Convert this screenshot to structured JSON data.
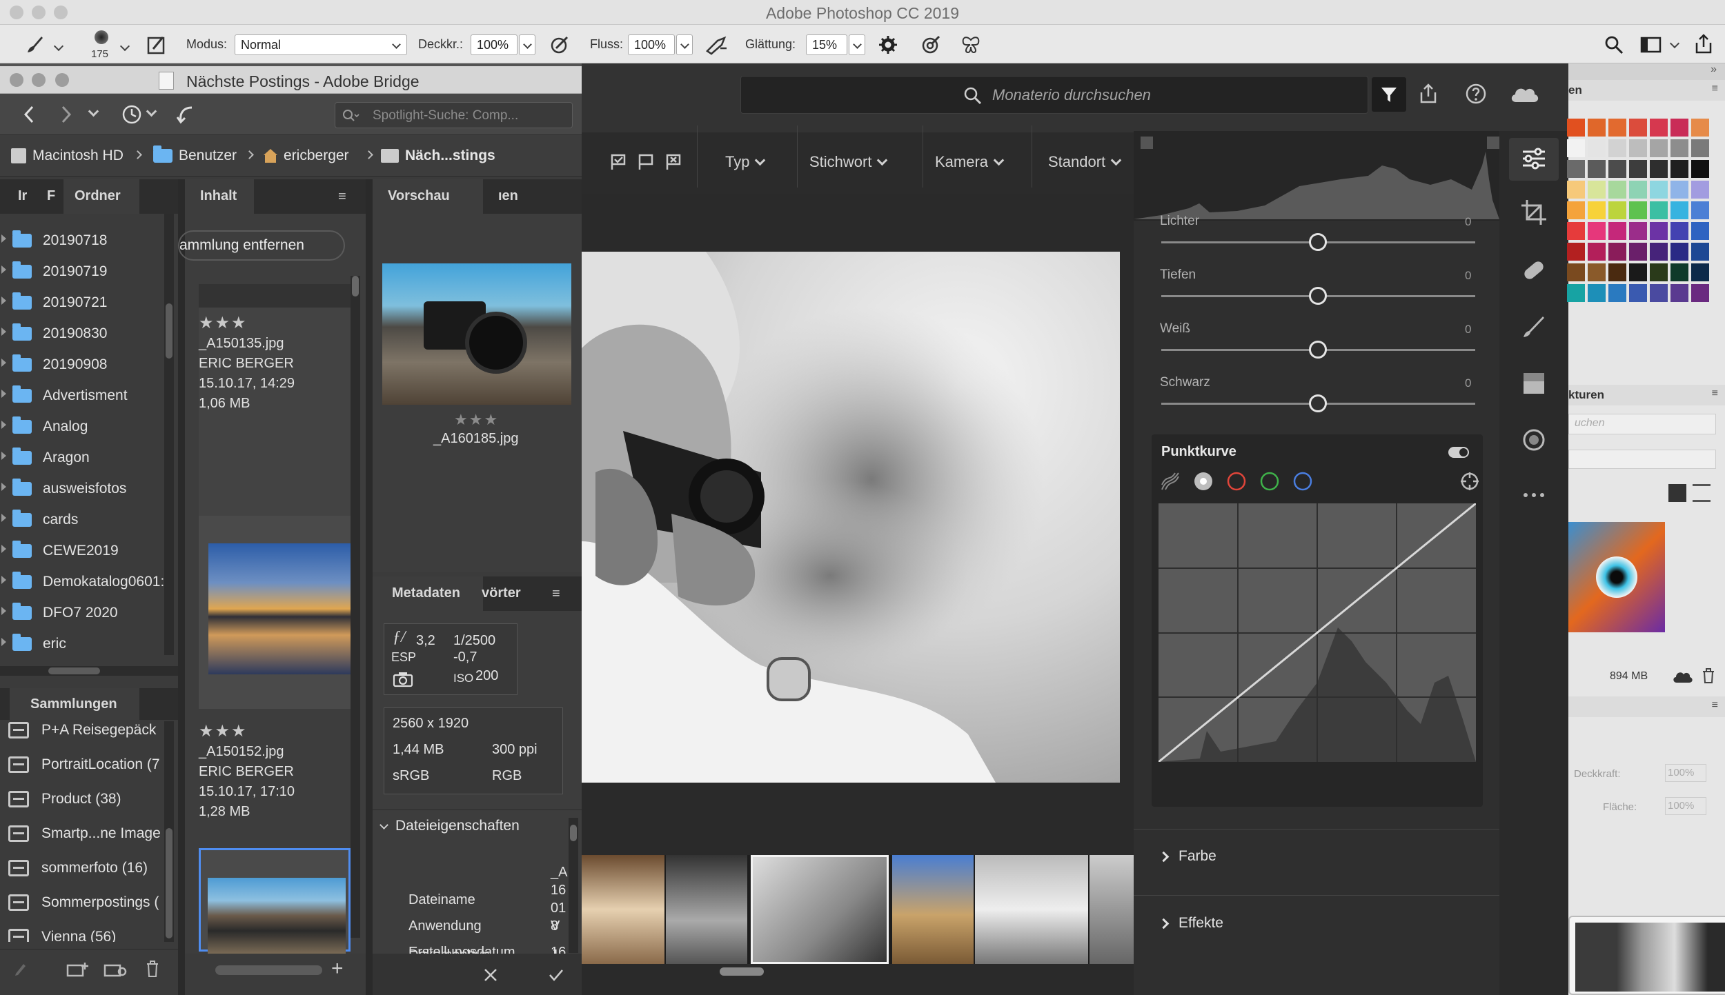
{
  "photoshop": {
    "title": "Adobe Photoshop CC 2019",
    "options": {
      "brush_size": "175",
      "mode_label": "Modus:",
      "mode_value": "Normal",
      "opacity_label": "Deckkr.:",
      "opacity_value": "100%",
      "flow_label": "Fluss:",
      "flow_value": "100%",
      "smoothing_label": "Glättung:",
      "smoothing_value": "15%"
    },
    "right_panels": {
      "tab_swatches": "en",
      "tab_textures": "kturen",
      "search_placeholder": "uchen",
      "cloud_size": "894 MB",
      "opacity_label": "Deckkraft:",
      "opacity_value": "100%",
      "fill_label": "Fläche:",
      "fill_value": "100%"
    }
  },
  "bridge": {
    "title": "Nächste Postings - Adobe Bridge",
    "search_placeholder": "Spotlight-Suche: Comp...",
    "breadcrumb": [
      "Macintosh HD",
      "Benutzer",
      "ericberger",
      "Näch...stings"
    ],
    "left_tabs": [
      "Ir",
      "F",
      "Ordner"
    ],
    "folders": [
      "20190718",
      "20190719",
      "20190721",
      "20190830",
      "20190908",
      "Advertisment",
      "Analog",
      "Aragon",
      "ausweisfotos",
      "cards",
      "CEWE2019",
      "Demokatalog0601:",
      "DFO7 2020",
      "eric"
    ],
    "collections_tab": "Sammlungen",
    "collections": [
      "P+A Reisegepäck",
      "PortraitLocation (7",
      "Product  (38)",
      "Smartp...ne Image",
      "sommerfoto  (16)",
      "Sommerpostings  (",
      "Vienna  (56)"
    ],
    "content_tab": "Inhalt",
    "remove_button": "ammlung entfernen",
    "items": [
      {
        "stars": "★★★",
        "file": "_A150135.jpg",
        "author": "ERIC BERGER",
        "date": "15.10.17, 14:29",
        "size": "1,06 MB"
      },
      {
        "stars": "★★★",
        "file": "_A150152.jpg",
        "author": "ERIC BERGER",
        "date": "15.10.17, 17:10",
        "size": "1,28 MB"
      }
    ],
    "preview_tab": "Vorschau",
    "preview_tab2": "ıen",
    "preview": {
      "stars": "★★★",
      "file": "_A160185.jpg"
    },
    "metadata_tab": "Metadaten",
    "metadata_tab2": "vörter",
    "exif": {
      "aperture": "3,2",
      "shutter": "1/2500",
      "esp_label": "ESP",
      "esp": "-0,7",
      "iso_label": "ISO",
      "iso": "200"
    },
    "file_info": {
      "dimensions": "2560 x 1920",
      "size": "1,44 MB",
      "ppi": "300 ppi",
      "profile": "sRGB",
      "mode": "RGB"
    },
    "file_props_header": "Dateieigenschaften",
    "file_props": [
      {
        "label": "Dateiname",
        "value": "_A\n16\n01\n8"
      },
      {
        "label": "Dokumenttyp",
        "value": "J"
      },
      {
        "label": "Anwendung",
        "value": "V"
      },
      {
        "label": "Erstellungsdatum",
        "value": "16"
      }
    ]
  },
  "lightroom": {
    "search_placeholder": "Monaterio durchsuchen",
    "filters": [
      "Typ",
      "Stichwort",
      "Kamera",
      "Standort"
    ],
    "sliders": [
      {
        "label": "Lichter",
        "value": "0"
      },
      {
        "label": "Tiefen",
        "value": "0"
      },
      {
        "label": "Weiß",
        "value": "0"
      },
      {
        "label": "Schwarz",
        "value": "0"
      }
    ],
    "curve_title": "Punktkurve",
    "sections": [
      "Farbe",
      "Effekte"
    ]
  }
}
